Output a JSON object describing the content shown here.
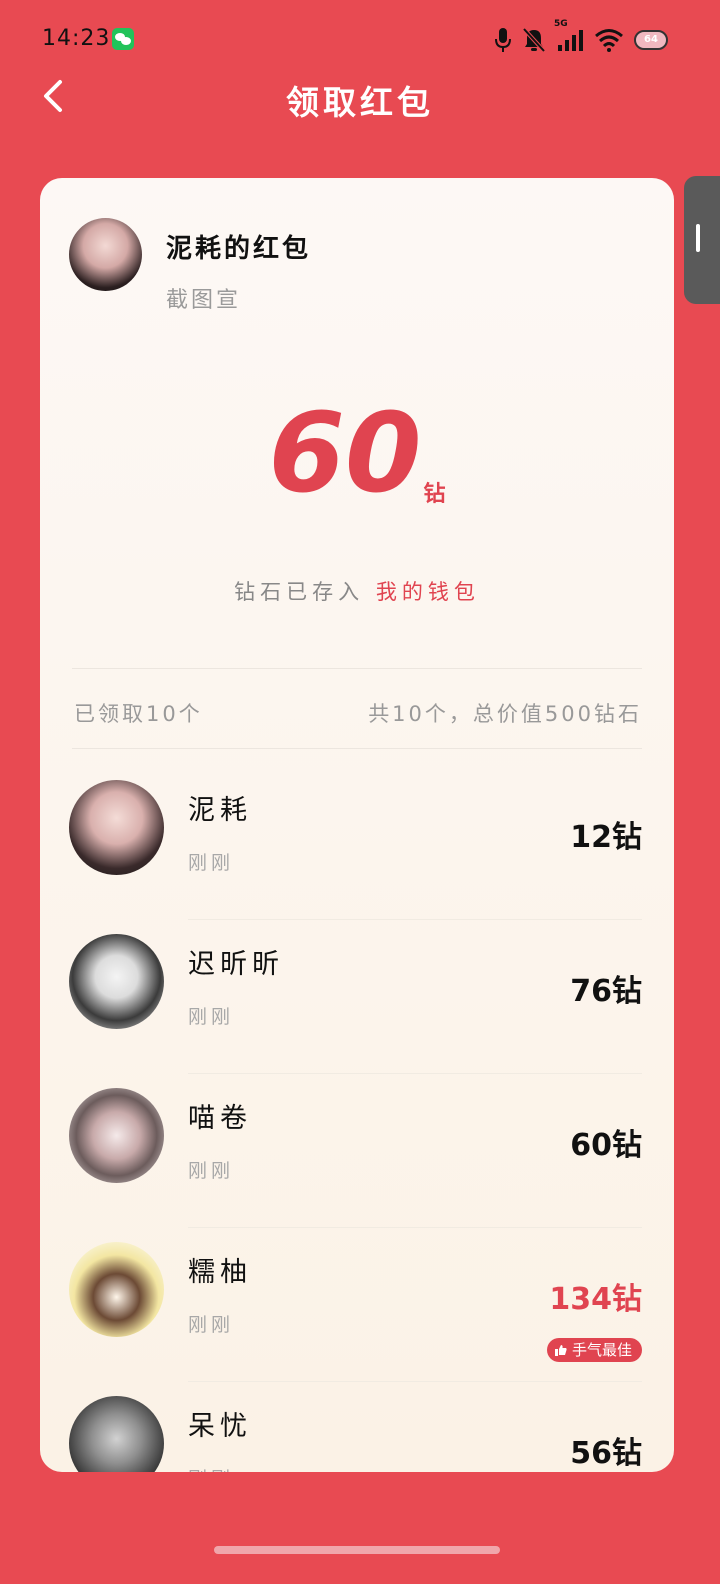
{
  "status_bar": {
    "time": "14:23",
    "network": "5G",
    "battery": "64"
  },
  "nav": {
    "title": "领取红包"
  },
  "sender": {
    "title": "泥耗的红包",
    "subtitle": "截图宣"
  },
  "amount": {
    "value": "60",
    "unit": "钻"
  },
  "wallet": {
    "prefix": "钻石已存入",
    "link": "我的钱包"
  },
  "summary": {
    "claimed": "已领取10个",
    "total": "共10个，总价值500钻石"
  },
  "claims": [
    {
      "name": "泥耗",
      "time": "刚刚",
      "amount": "12钻"
    },
    {
      "name": "迟昕昕",
      "time": "刚刚",
      "amount": "76钻"
    },
    {
      "name": "喵卷",
      "time": "刚刚",
      "amount": "60钻"
    },
    {
      "name": "糯柚",
      "time": "刚刚",
      "amount": "134钻",
      "badge": "手气最佳"
    },
    {
      "name": "呆忧",
      "time": "刚刚",
      "amount": "56钻"
    }
  ],
  "colors": {
    "background": "#e84a52",
    "accent": "#e04450",
    "card": "#fdf8f5"
  },
  "icons": {
    "back": "chevron-left-icon",
    "wechat": "wechat-icon",
    "mic": "mic-icon",
    "mute": "bell-off-icon",
    "signal": "signal-icon",
    "wifi": "wifi-icon",
    "battery": "battery-icon",
    "thumb": "thumbs-up-icon"
  }
}
